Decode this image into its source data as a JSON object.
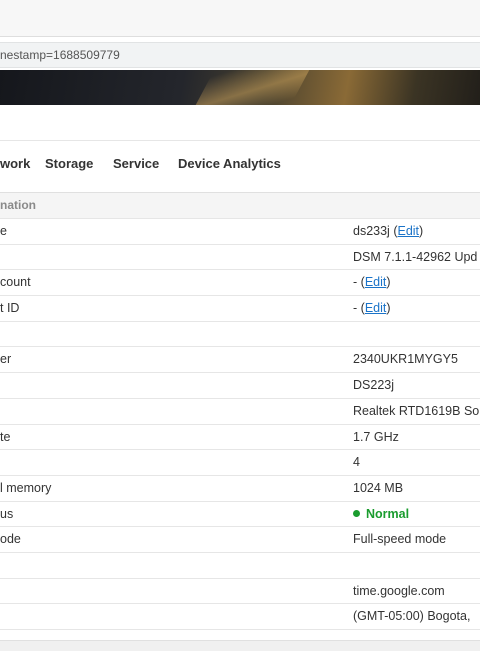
{
  "browser": {
    "url_fragment": "nestamp=1688509779"
  },
  "tabs": [
    {
      "label": "work"
    },
    {
      "label": "Storage"
    },
    {
      "label": "Service"
    },
    {
      "label": "Device Analytics"
    }
  ],
  "section": {
    "title": "nation"
  },
  "rows": [
    {
      "label": "e",
      "value": "ds233j",
      "edit": "Edit"
    },
    {
      "label": "",
      "value": "DSM 7.1.1-42962 Upd"
    },
    {
      "label": "count",
      "value": "-",
      "edit": "Edit"
    },
    {
      "label": "t ID",
      "value": "-",
      "edit": "Edit"
    },
    {
      "label": "",
      "value": ""
    },
    {
      "label": "er",
      "value": "2340UKR1MYGY5"
    },
    {
      "label": "",
      "value": "DS223j"
    },
    {
      "label": "",
      "value": "Realtek RTD1619B So"
    },
    {
      "label": "te",
      "value": "1.7 GHz"
    },
    {
      "label": "",
      "value": "4"
    },
    {
      "label": "l memory",
      "value": "1024 MB"
    },
    {
      "label": "us",
      "value": "Normal",
      "status_color": "#1a9c2e"
    },
    {
      "label": "ode",
      "value": "Full-speed mode"
    },
    {
      "label": "",
      "value": ""
    },
    {
      "label": "",
      "value": "time.google.com"
    },
    {
      "label": "",
      "value": "(GMT-05:00) Bogota,"
    }
  ]
}
